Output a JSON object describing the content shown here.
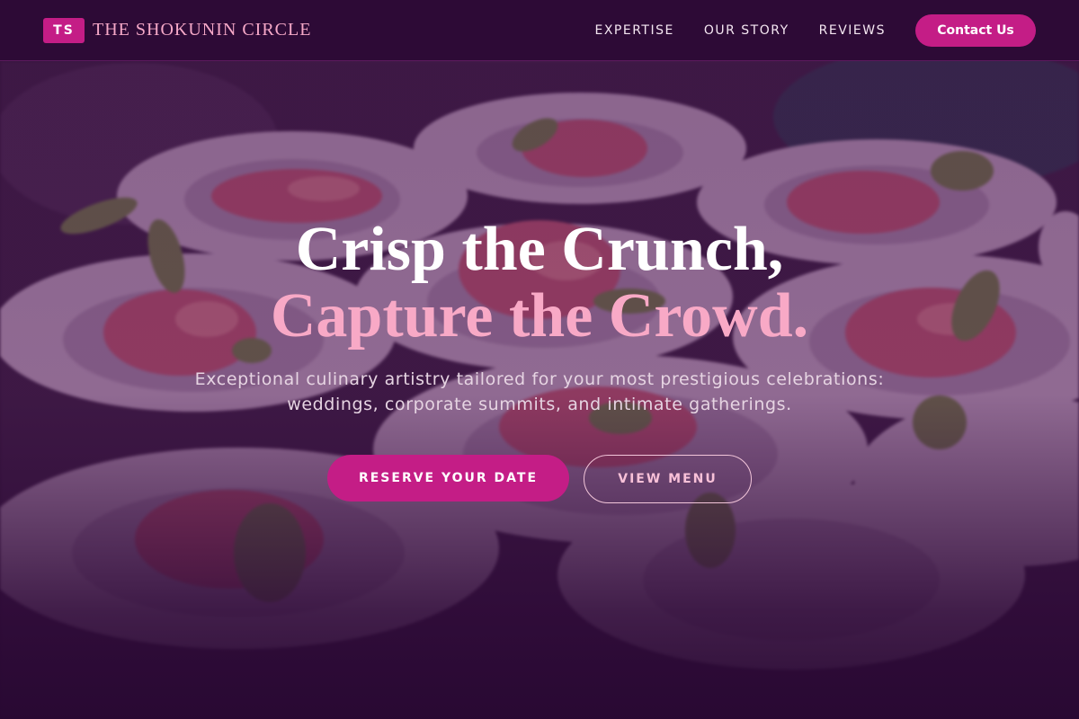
{
  "brand": {
    "badge": "TS",
    "name": "THE SHOKUNIN CIRCLE",
    "accent_color": "#c41d86",
    "name_color": "#f6a9c8"
  },
  "nav": {
    "links": [
      "EXPERTISE",
      "OUR STORY",
      "REVIEWS"
    ],
    "contact_label": "Contact Us",
    "background_color": "#2d0a36"
  },
  "hero": {
    "headline_line1": "Crisp the Crunch,",
    "headline_line2": "Capture the Crowd.",
    "headline_line2_color": "#f8a9c6",
    "subtitle_line1": "Exceptional culinary artistry tailored for your most prestigious celebrations:",
    "subtitle_line2": "weddings, corporate summits, and intimate gatherings.",
    "primary_cta": "RESERVE YOUR DATE",
    "secondary_cta": "VIEW MENU",
    "background_image": "plated-hors-d-oeuvres-photo"
  }
}
